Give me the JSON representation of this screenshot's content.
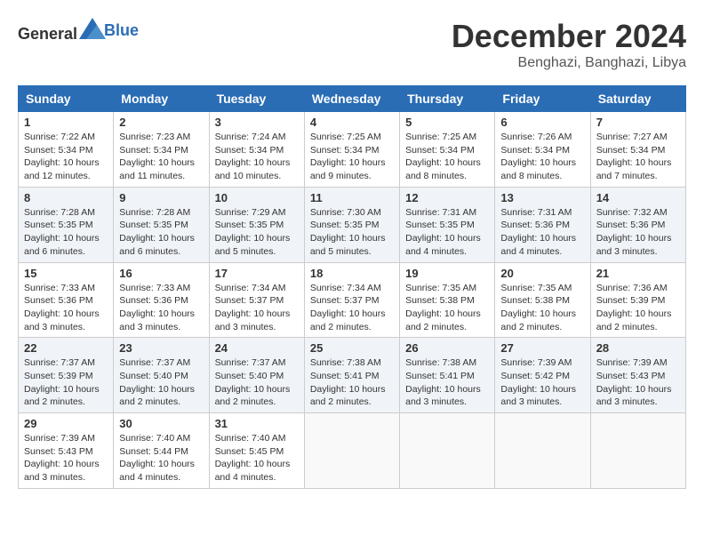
{
  "header": {
    "logo": {
      "text_general": "General",
      "text_blue": "Blue"
    },
    "title": "December 2024",
    "location": "Benghazi, Banghazi, Libya"
  },
  "weekdays": [
    "Sunday",
    "Monday",
    "Tuesday",
    "Wednesday",
    "Thursday",
    "Friday",
    "Saturday"
  ],
  "weeks": [
    [
      {
        "day": "1",
        "sunrise": "7:22 AM",
        "sunset": "5:34 PM",
        "daylight": "10 hours and 12 minutes."
      },
      {
        "day": "2",
        "sunrise": "7:23 AM",
        "sunset": "5:34 PM",
        "daylight": "10 hours and 11 minutes."
      },
      {
        "day": "3",
        "sunrise": "7:24 AM",
        "sunset": "5:34 PM",
        "daylight": "10 hours and 10 minutes."
      },
      {
        "day": "4",
        "sunrise": "7:25 AM",
        "sunset": "5:34 PM",
        "daylight": "10 hours and 9 minutes."
      },
      {
        "day": "5",
        "sunrise": "7:25 AM",
        "sunset": "5:34 PM",
        "daylight": "10 hours and 8 minutes."
      },
      {
        "day": "6",
        "sunrise": "7:26 AM",
        "sunset": "5:34 PM",
        "daylight": "10 hours and 8 minutes."
      },
      {
        "day": "7",
        "sunrise": "7:27 AM",
        "sunset": "5:34 PM",
        "daylight": "10 hours and 7 minutes."
      }
    ],
    [
      {
        "day": "8",
        "sunrise": "7:28 AM",
        "sunset": "5:35 PM",
        "daylight": "10 hours and 6 minutes."
      },
      {
        "day": "9",
        "sunrise": "7:28 AM",
        "sunset": "5:35 PM",
        "daylight": "10 hours and 6 minutes."
      },
      {
        "day": "10",
        "sunrise": "7:29 AM",
        "sunset": "5:35 PM",
        "daylight": "10 hours and 5 minutes."
      },
      {
        "day": "11",
        "sunrise": "7:30 AM",
        "sunset": "5:35 PM",
        "daylight": "10 hours and 5 minutes."
      },
      {
        "day": "12",
        "sunrise": "7:31 AM",
        "sunset": "5:35 PM",
        "daylight": "10 hours and 4 minutes."
      },
      {
        "day": "13",
        "sunrise": "7:31 AM",
        "sunset": "5:36 PM",
        "daylight": "10 hours and 4 minutes."
      },
      {
        "day": "14",
        "sunrise": "7:32 AM",
        "sunset": "5:36 PM",
        "daylight": "10 hours and 3 minutes."
      }
    ],
    [
      {
        "day": "15",
        "sunrise": "7:33 AM",
        "sunset": "5:36 PM",
        "daylight": "10 hours and 3 minutes."
      },
      {
        "day": "16",
        "sunrise": "7:33 AM",
        "sunset": "5:36 PM",
        "daylight": "10 hours and 3 minutes."
      },
      {
        "day": "17",
        "sunrise": "7:34 AM",
        "sunset": "5:37 PM",
        "daylight": "10 hours and 3 minutes."
      },
      {
        "day": "18",
        "sunrise": "7:34 AM",
        "sunset": "5:37 PM",
        "daylight": "10 hours and 2 minutes."
      },
      {
        "day": "19",
        "sunrise": "7:35 AM",
        "sunset": "5:38 PM",
        "daylight": "10 hours and 2 minutes."
      },
      {
        "day": "20",
        "sunrise": "7:35 AM",
        "sunset": "5:38 PM",
        "daylight": "10 hours and 2 minutes."
      },
      {
        "day": "21",
        "sunrise": "7:36 AM",
        "sunset": "5:39 PM",
        "daylight": "10 hours and 2 minutes."
      }
    ],
    [
      {
        "day": "22",
        "sunrise": "7:37 AM",
        "sunset": "5:39 PM",
        "daylight": "10 hours and 2 minutes."
      },
      {
        "day": "23",
        "sunrise": "7:37 AM",
        "sunset": "5:40 PM",
        "daylight": "10 hours and 2 minutes."
      },
      {
        "day": "24",
        "sunrise": "7:37 AM",
        "sunset": "5:40 PM",
        "daylight": "10 hours and 2 minutes."
      },
      {
        "day": "25",
        "sunrise": "7:38 AM",
        "sunset": "5:41 PM",
        "daylight": "10 hours and 2 minutes."
      },
      {
        "day": "26",
        "sunrise": "7:38 AM",
        "sunset": "5:41 PM",
        "daylight": "10 hours and 3 minutes."
      },
      {
        "day": "27",
        "sunrise": "7:39 AM",
        "sunset": "5:42 PM",
        "daylight": "10 hours and 3 minutes."
      },
      {
        "day": "28",
        "sunrise": "7:39 AM",
        "sunset": "5:43 PM",
        "daylight": "10 hours and 3 minutes."
      }
    ],
    [
      {
        "day": "29",
        "sunrise": "7:39 AM",
        "sunset": "5:43 PM",
        "daylight": "10 hours and 3 minutes."
      },
      {
        "day": "30",
        "sunrise": "7:40 AM",
        "sunset": "5:44 PM",
        "daylight": "10 hours and 4 minutes."
      },
      {
        "day": "31",
        "sunrise": "7:40 AM",
        "sunset": "5:45 PM",
        "daylight": "10 hours and 4 minutes."
      },
      null,
      null,
      null,
      null
    ]
  ]
}
